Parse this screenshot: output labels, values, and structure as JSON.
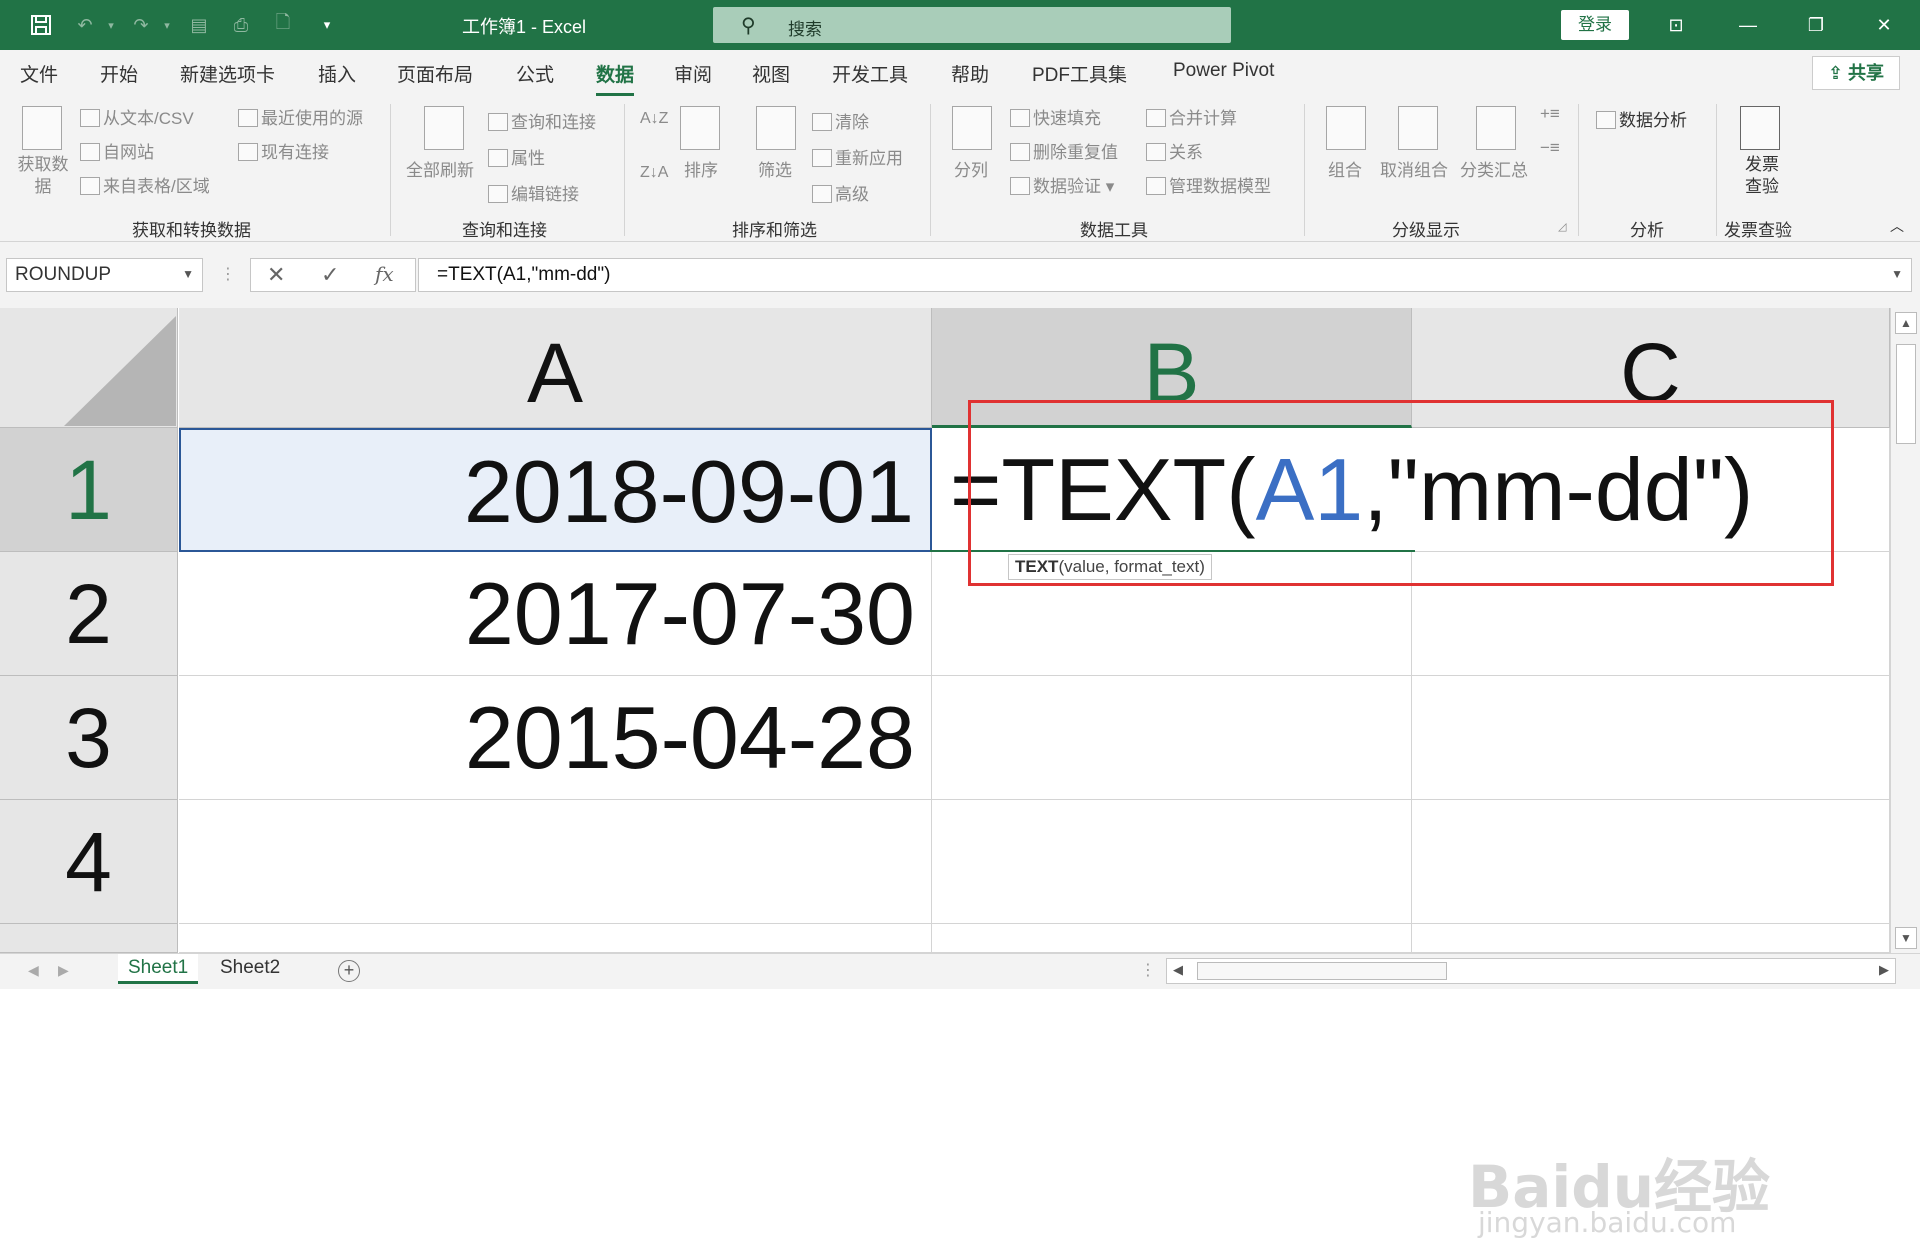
{
  "titlebar": {
    "title": "工作簿1  -  Excel",
    "search_placeholder": "搜索",
    "login": "登录"
  },
  "tabs": [
    {
      "label": "文件"
    },
    {
      "label": "开始"
    },
    {
      "label": "新建选项卡"
    },
    {
      "label": "插入"
    },
    {
      "label": "页面布局"
    },
    {
      "label": "公式"
    },
    {
      "label": "数据",
      "active": true
    },
    {
      "label": "审阅"
    },
    {
      "label": "视图"
    },
    {
      "label": "开发工具"
    },
    {
      "label": "帮助"
    },
    {
      "label": "PDF工具集"
    },
    {
      "label": "Power Pivot"
    }
  ],
  "share_label": "共享",
  "ribbon": {
    "get_data": "获取数\n据",
    "from_text": "从文本/CSV",
    "from_web": "自网站",
    "from_table": "来自表格/区域",
    "recent_sources": "最近使用的源",
    "existing_conn": "现有连接",
    "group1_label": "获取和转换数据",
    "refresh_all": "全部刷新",
    "queries_conn": "查询和连接",
    "properties": "属性",
    "edit_links": "编辑链接",
    "group2_label": "查询和连接",
    "sort": "排序",
    "filter": "筛选",
    "clear": "清除",
    "reapply": "重新应用",
    "advanced": "高级",
    "group3_label": "排序和筛选",
    "split": "分列",
    "flash_fill": "快速填充",
    "remove_dup": "删除重复值",
    "validation": "数据验证",
    "consolidate": "合并计算",
    "relations": "关系",
    "manage_model": "管理数据模型",
    "group4_label": "数据工具",
    "group_btn": "组合",
    "ungroup_btn": "取消组合",
    "subtotal": "分类汇总",
    "group5_label": "分级显示",
    "data_analysis": "数据分析",
    "group6_label": "分析",
    "invoice_check": "发票\n查验",
    "group7_label": "发票查验"
  },
  "formula_bar": {
    "name_box": "ROUNDUP",
    "formula": "=TEXT(A1,\"mm-dd\")"
  },
  "columns": [
    "A",
    "B",
    "C"
  ],
  "rows": [
    "1",
    "2",
    "3",
    "4"
  ],
  "cells": {
    "A1": "2018-09-01",
    "A2": "2017-07-30",
    "A3": "2015-04-28"
  },
  "editing": {
    "prefix": "=TEXT(",
    "ref": "A1",
    "suffix": ",\"mm-dd\")",
    "tooltip_func": "TEXT",
    "tooltip_args": "(value, format_text)"
  },
  "sheets": [
    {
      "label": "Sheet1",
      "active": true
    },
    {
      "label": "Sheet2"
    }
  ],
  "watermark": {
    "main": "Baidu经验",
    "sub": "jingyan.baidu.com"
  },
  "colors": {
    "accent": "#217346",
    "highlight_box": "#e03232",
    "ref_blue": "#3b6fc4"
  }
}
